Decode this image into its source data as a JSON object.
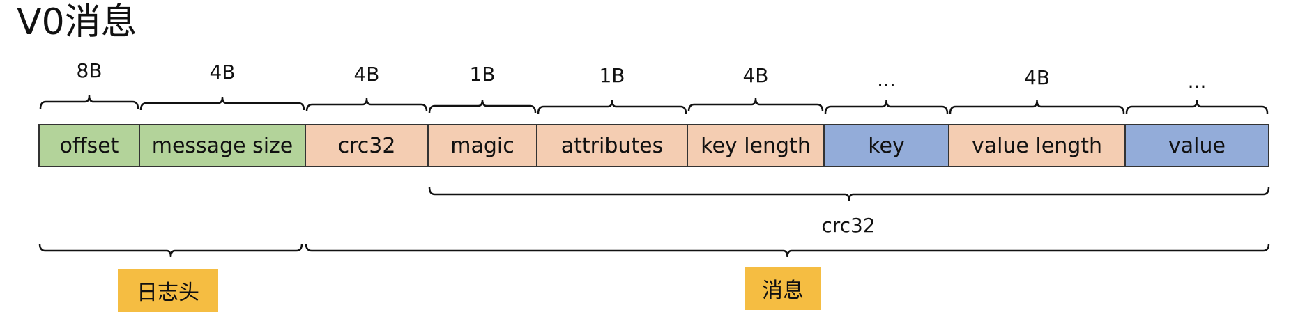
{
  "title": "V0消息",
  "fields": [
    {
      "label": "offset",
      "size": "8B",
      "color": "#b3d39a"
    },
    {
      "label": "message size",
      "size": "4B",
      "color": "#b3d39a"
    },
    {
      "label": "crc32",
      "size": "4B",
      "color": "#f4cdb2"
    },
    {
      "label": "magic",
      "size": "1B",
      "color": "#f4cdb2"
    },
    {
      "label": "attributes",
      "size": "1B",
      "color": "#f4cdb2"
    },
    {
      "label": "key length",
      "size": "4B",
      "color": "#f4cdb2"
    },
    {
      "label": "key",
      "size": "...",
      "color": "#93acd9"
    },
    {
      "label": "value length",
      "size": "4B",
      "color": "#f4cdb2"
    },
    {
      "label": "value",
      "size": "...",
      "color": "#93acd9"
    }
  ],
  "checksum_span": {
    "label": "crc32"
  },
  "sections": [
    {
      "label": "日志头",
      "color": "#f5bd42"
    },
    {
      "label": "消息",
      "color": "#f5bd42"
    }
  ]
}
